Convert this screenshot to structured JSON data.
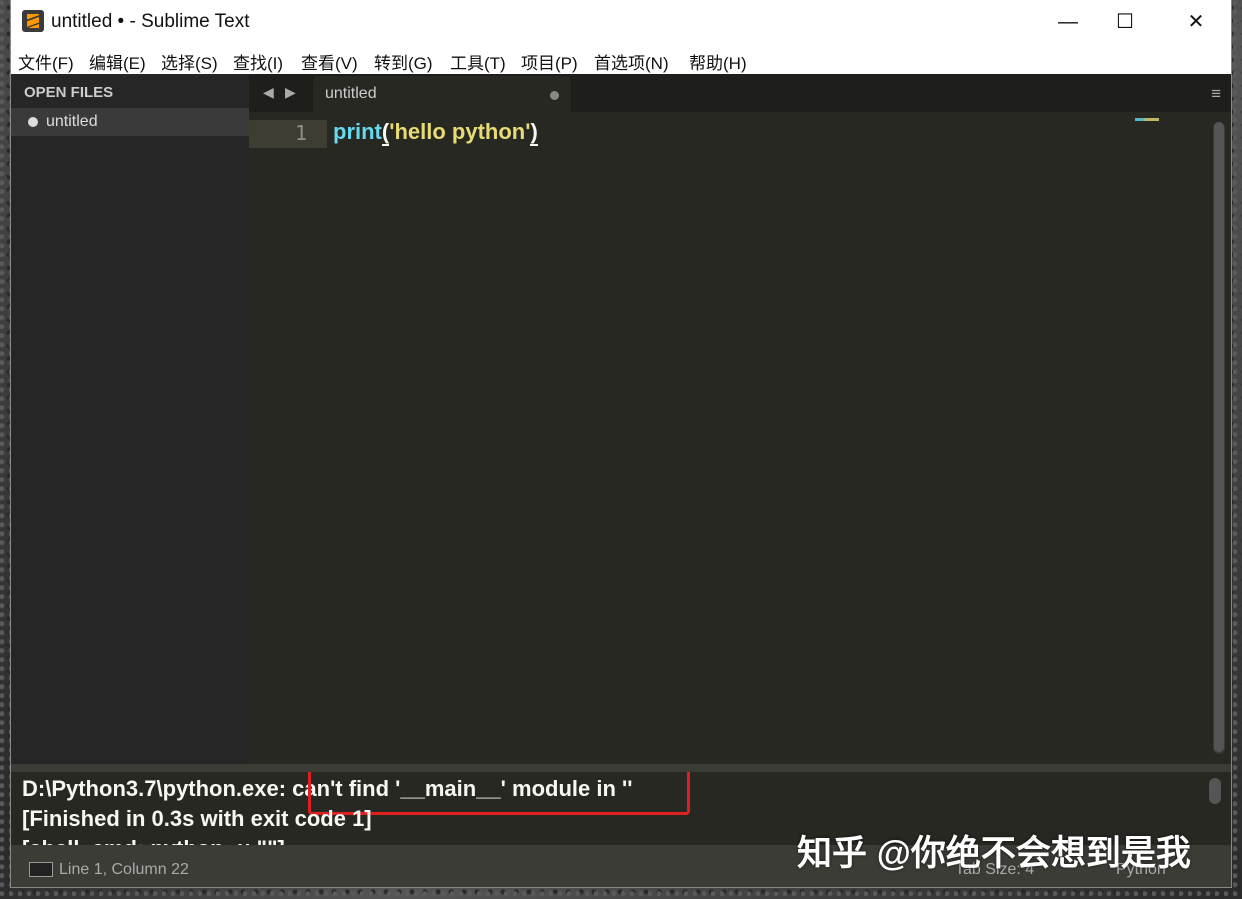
{
  "window": {
    "title": "untitled • - Sublime Text"
  },
  "controls": {
    "minimize": "—",
    "maximize": "☐",
    "close": "✕"
  },
  "menu": [
    "文件(F)",
    "编辑(E)",
    "选择(S)",
    "查找(I)",
    "查看(V)",
    "转到(G)",
    "工具(T)",
    "项目(P)",
    "首选项(N)",
    "帮助(H)"
  ],
  "sidebar": {
    "header": "OPEN FILES",
    "file": "untitled"
  },
  "tabs": {
    "prev": "◀",
    "next": "▶",
    "active": "untitled",
    "menu_icon": "≡"
  },
  "editor": {
    "line_number": "1",
    "code": {
      "func": "print",
      "open": "(",
      "string": "'hello python'",
      "close": ")"
    }
  },
  "console": {
    "line1_prefix": "D:\\Python3.7\\python.exe: ",
    "line1_error": "can't find '__main__' module in ''",
    "line2": "[Finished in 0.3s with exit code 1]",
    "line3": "[shell_cmd: python -u \"\"]"
  },
  "status": {
    "position": "Line 1, Column 22",
    "tab_size": "Tab Size: 4",
    "syntax": "Python"
  },
  "watermark": "知乎 @你绝不会想到是我",
  "colors": {
    "accent_highlight": "#e02020",
    "keyword": "#66d9ef",
    "string": "#e6db74"
  }
}
